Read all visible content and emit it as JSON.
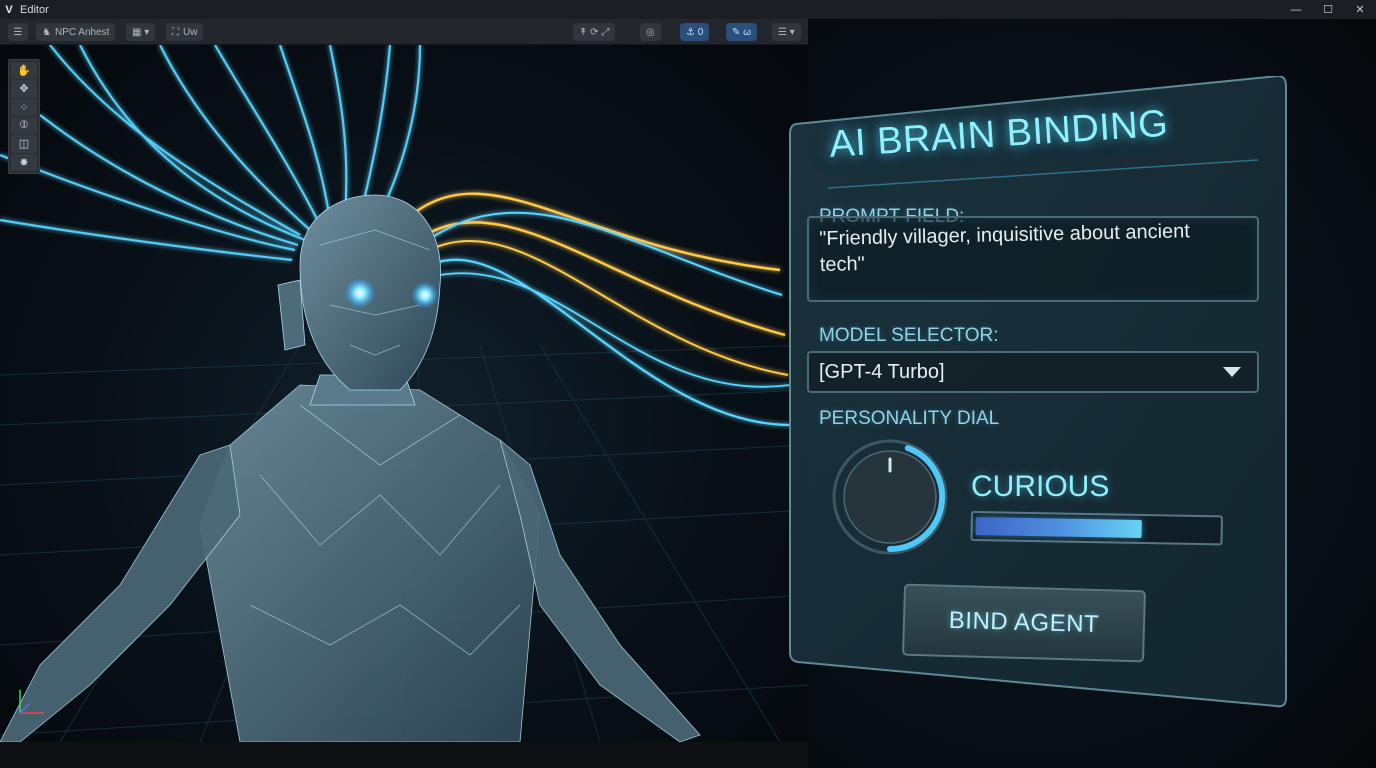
{
  "window": {
    "title": "Editor",
    "logo_glyph": "V",
    "controls": {
      "minimize": "—",
      "maximize": "☐",
      "close": "✕"
    }
  },
  "toolbar": {
    "menu_glyph": "☰",
    "object_name": "NPC Anhest",
    "layout_glyph": "▦ ▾",
    "view_label": "Uw",
    "transform_glyphs": "↟ ⟳ ⤢",
    "pivot_glyph": "◎",
    "snap_glyphs": "⚓ 0",
    "brush_glyphs": "✎ ω",
    "layers_glyph": "☰ ▾"
  },
  "palette": {
    "tools": [
      {
        "name": "hand-tool",
        "glyph": "✋"
      },
      {
        "name": "move-tool",
        "glyph": "✥"
      },
      {
        "name": "scale-tool",
        "glyph": "⁘"
      },
      {
        "name": "rotate-tool",
        "glyph": "⦶"
      },
      {
        "name": "rect-tool",
        "glyph": "◫"
      },
      {
        "name": "custom-tool",
        "glyph": "✸"
      }
    ]
  },
  "panel": {
    "title": "AI BRAIN BINDING",
    "prompt_label": "PROMPT FIELD:",
    "prompt_value": "\"Friendly villager, inquisitive about ancient tech\"",
    "model_label": "MODEL SELECTOR:",
    "model_value": "[GPT-4 Turbo]",
    "personality_label": "PERSONALITY DIAL",
    "personality_value": "CURIOUS",
    "personality_level": 0.68,
    "bind_button": "BIND AGENT"
  },
  "colors": {
    "accent": "#8ff1ff",
    "wire_blue": "#5ad6ff",
    "wire_gold": "#ffc94a",
    "panel_border": "#5e8a96"
  }
}
